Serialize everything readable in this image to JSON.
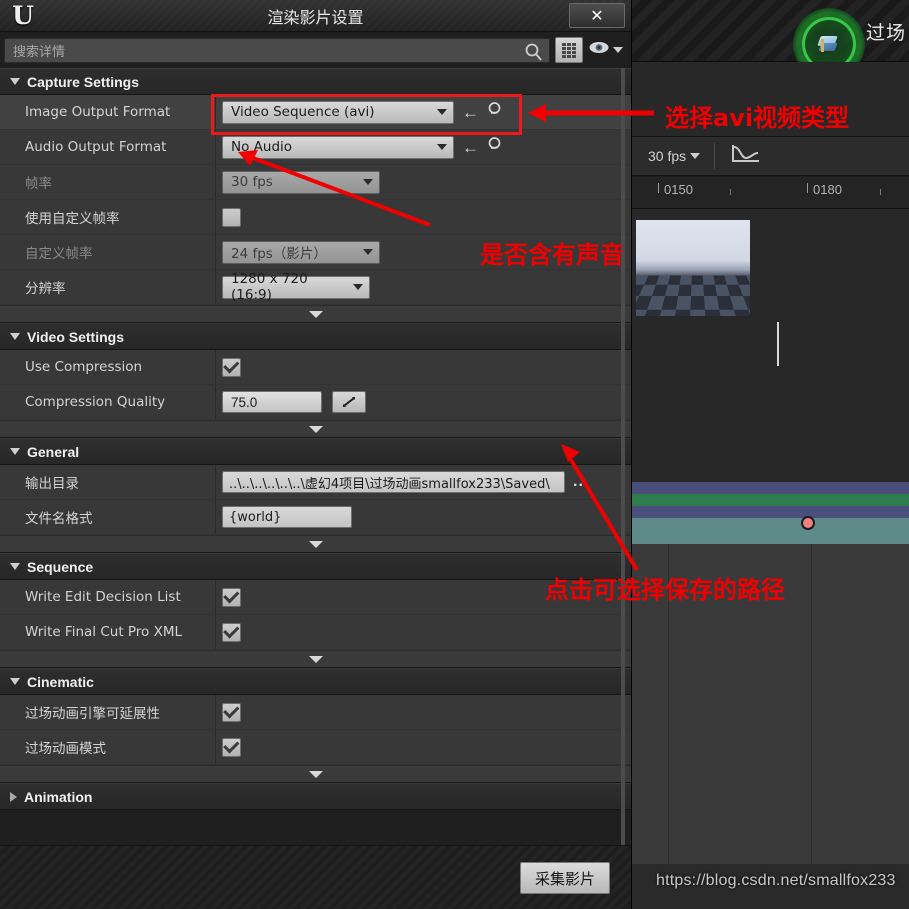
{
  "window": {
    "title": "渲染影片设置",
    "logo": "unreal-engine-logo",
    "close_label": "✕"
  },
  "search": {
    "placeholder": "搜索详情",
    "value": "",
    "search_icon": "magnifier-icon",
    "view_button_icon": "grid-view-icon",
    "visibility_icon": "eye-icon",
    "visibility_caret": "chevron-down-icon"
  },
  "sections": [
    {
      "id": "capture-settings",
      "title": "Capture Settings",
      "expanded": true,
      "rows": [
        {
          "label": "Image Output Format",
          "type": "combo",
          "value": "Video Sequence (avi)",
          "width": "wide",
          "disabled": false,
          "has_revert": true,
          "has_search": true,
          "hover": true
        },
        {
          "label": "Audio Output Format",
          "type": "combo",
          "value": "No Audio",
          "width": "wide",
          "disabled": false,
          "has_revert": true,
          "has_search": true,
          "hover": false
        },
        {
          "label": "帧率",
          "type": "combo",
          "value": "30 fps",
          "width": "mid",
          "disabled": true,
          "has_revert": false,
          "has_search": false,
          "hover": false
        },
        {
          "label": "使用自定义帧率",
          "type": "checkbox",
          "value": false,
          "disabled": false,
          "hover": false
        },
        {
          "label": "自定义帧率",
          "type": "combo",
          "value": "24 fps（影片）",
          "width": "mid",
          "disabled": true,
          "has_revert": false,
          "has_search": false,
          "hover": false
        },
        {
          "label": "分辨率",
          "type": "combo",
          "value": "1280 x 720 (16:9)",
          "width": "res",
          "disabled": false,
          "has_revert": false,
          "has_search": false,
          "hover": false
        }
      ]
    },
    {
      "id": "video-settings",
      "title": "Video Settings",
      "expanded": true,
      "rows": [
        {
          "label": "Use Compression",
          "type": "checkbox",
          "value": true,
          "disabled": false,
          "hover": false
        },
        {
          "label": "Compression Quality",
          "type": "number",
          "value": "75.0",
          "spin_icon": "resize-arrows-icon",
          "disabled": false,
          "hover": false
        }
      ]
    },
    {
      "id": "general",
      "title": "General",
      "expanded": true,
      "rows": [
        {
          "label": "输出目录",
          "type": "path",
          "value": "..\\..\\..\\..\\..\\..\\虚幻4项目\\过场动画smallfox233\\Saved\\",
          "browse_label": "...",
          "disabled": false,
          "hover": false
        },
        {
          "label": "文件名格式",
          "type": "text",
          "value": "{world}",
          "disabled": false,
          "hover": false
        }
      ]
    },
    {
      "id": "sequence",
      "title": "Sequence",
      "expanded": true,
      "rows": [
        {
          "label": "Write Edit Decision List",
          "type": "checkbox",
          "value": true,
          "disabled": false,
          "hover": false
        },
        {
          "label": "Write Final Cut Pro XML",
          "type": "checkbox",
          "value": true,
          "disabled": false,
          "hover": false
        }
      ]
    },
    {
      "id": "cinematic",
      "title": "Cinematic",
      "expanded": true,
      "rows": [
        {
          "label": "过场动画引擎可延展性",
          "type": "checkbox",
          "value": true,
          "disabled": false,
          "hover": false
        },
        {
          "label": "过场动画模式",
          "type": "checkbox",
          "value": true,
          "disabled": false,
          "hover": false
        }
      ]
    },
    {
      "id": "animation",
      "title": "Animation",
      "expanded": false,
      "rows": []
    }
  ],
  "footer": {
    "capture_button": "采集影片"
  },
  "annotations": [
    {
      "id": "avi-type",
      "text": "选择avi视频类型",
      "kind": "arrow-left-box"
    },
    {
      "id": "audio",
      "text": "是否含有声音",
      "kind": "arrow-up-left"
    },
    {
      "id": "path",
      "text": "点击可选择保存的路径",
      "kind": "arrow-up-left"
    }
  ],
  "background": {
    "scene_label": "过场",
    "fps_label": "30 fps",
    "fps_caret": "chevron-down-icon",
    "curve_icon": "curve-graph-icon",
    "ruler_ticks": [
      "0150",
      "0180"
    ],
    "highlight_icon": "sequence-cube-icon",
    "watermark": "https://blog.csdn.net/smallfox233"
  },
  "colors": {
    "accent_red": "#f00000",
    "box_red": "#e81c1c",
    "panel_bg": "#383838",
    "header_bg": "#2e2e2e",
    "green_glow": "#3cdc50",
    "track_purple": "#4a4e7a",
    "track_green": "#2f7d4f",
    "track_teal": "#5e8a8a",
    "keyframe": "#f08080"
  }
}
